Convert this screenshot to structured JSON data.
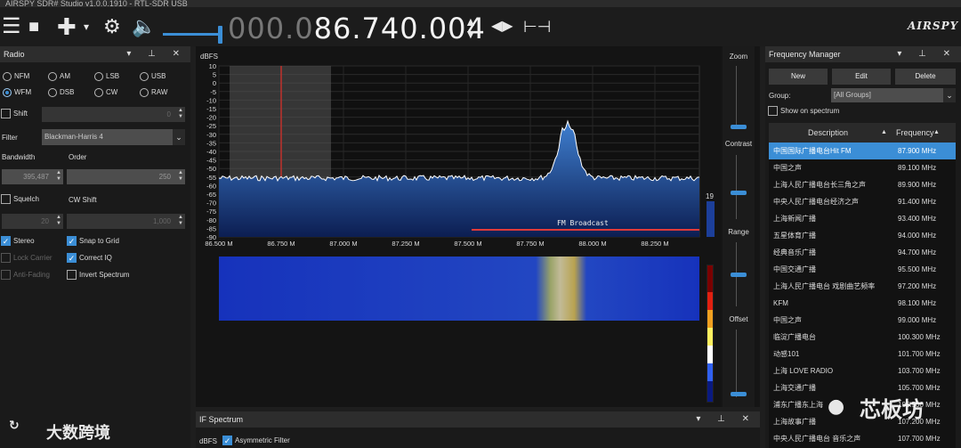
{
  "window": {
    "title": "AIRSPY SDR# Studio v1.0.0.1910 - RTL-SDR USB"
  },
  "toolbar": {
    "freq_dim": "000.0",
    "freq_bright": "86.740.004",
    "logo": "AIRSPY"
  },
  "radio_panel": {
    "title": "Radio",
    "modes": [
      {
        "label": "NFM",
        "selected": false
      },
      {
        "label": "AM",
        "selected": false
      },
      {
        "label": "LSB",
        "selected": false
      },
      {
        "label": "USB",
        "selected": false
      },
      {
        "label": "WFM",
        "selected": true
      },
      {
        "label": "DSB",
        "selected": false
      },
      {
        "label": "CW",
        "selected": false
      },
      {
        "label": "RAW",
        "selected": false
      }
    ],
    "shift_label": "Shift",
    "shift_value": "0",
    "filter_label": "Filter",
    "filter_value": "Blackman-Harris 4",
    "bandwidth_label": "Bandwidth",
    "order_label": "Order",
    "bandwidth_value": "395,487",
    "order_value": "250",
    "squelch_label": "Squelch",
    "cw_shift_label": "CW Shift",
    "squelch_value": "20",
    "cw_shift_value": "1,000",
    "stereo_label": "Stereo",
    "snap_label": "Snap to Grid",
    "lock_label": "Lock Carrier",
    "correct_iq_label": "Correct IQ",
    "anti_fading_label": "Anti-Fading",
    "invert_label": "Invert Spectrum"
  },
  "spectrum": {
    "y_unit": "dBFS",
    "y_ticks": [
      "10",
      "5",
      "0",
      "-5",
      "-10",
      "-15",
      "-20",
      "-25",
      "-30",
      "-35",
      "-40",
      "-45",
      "-50",
      "-55",
      "-60",
      "-65",
      "-70",
      "-75",
      "-80",
      "-85",
      "-90"
    ],
    "x_ticks": [
      "86.500 M",
      "86.750 M",
      "87.000 M",
      "87.250 M",
      "87.500 M",
      "87.750 M",
      "88.000 M",
      "88.250 M"
    ],
    "band_label": "FM Broadcast",
    "level_readout": "19"
  },
  "side_controls": {
    "zoom": "Zoom",
    "contrast": "Contrast",
    "range": "Range",
    "offset": "Offset"
  },
  "if_spectrum": {
    "title": "IF Spectrum",
    "unit": "dBFS",
    "asym_label": "Asymmetric Filter"
  },
  "freq_manager": {
    "title": "Frequency Manager",
    "new_label": "New",
    "edit_label": "Edit",
    "delete_label": "Delete",
    "group_label": "Group:",
    "group_value": "[All Groups]",
    "show_label": "Show on spectrum",
    "col_desc": "Description",
    "col_freq": "Frequency",
    "rows": [
      {
        "desc": "中国国际广播电台Hit FM",
        "freq": "87.900 MHz",
        "selected": true
      },
      {
        "desc": "中国之声",
        "freq": "89.100 MHz"
      },
      {
        "desc": "上海人民广播电台长三角之声",
        "freq": "89.900 MHz"
      },
      {
        "desc": "中央人民广播电台经济之声",
        "freq": "91.400 MHz"
      },
      {
        "desc": "上海新闻广播",
        "freq": "93.400 MHz"
      },
      {
        "desc": "五星体育广播",
        "freq": "94.000 MHz"
      },
      {
        "desc": "经典音乐广播",
        "freq": "94.700 MHz"
      },
      {
        "desc": "中国交通广播",
        "freq": "95.500 MHz"
      },
      {
        "desc": "上海人民广播电台 戏剧曲艺频率",
        "freq": "97.200 MHz"
      },
      {
        "desc": "KFM",
        "freq": "98.100 MHz"
      },
      {
        "desc": "中国之声",
        "freq": "99.000 MHz"
      },
      {
        "desc": "临淀广播电台",
        "freq": "100.300 MHz"
      },
      {
        "desc": "动感101",
        "freq": "101.700 MHz"
      },
      {
        "desc": "上海 LOVE RADIO",
        "freq": "103.700 MHz"
      },
      {
        "desc": "上海交通广播",
        "freq": "105.700 MHz"
      },
      {
        "desc": "浦东广播东上海",
        "freq": "106.500 MHz"
      },
      {
        "desc": "上海故事广播",
        "freq": "107.200 MHz"
      },
      {
        "desc": "中央人民广播电台 音乐之声",
        "freq": "107.700 MHz"
      }
    ]
  },
  "watermarks": {
    "left": "大数跨境",
    "right": "芯板坊"
  }
}
